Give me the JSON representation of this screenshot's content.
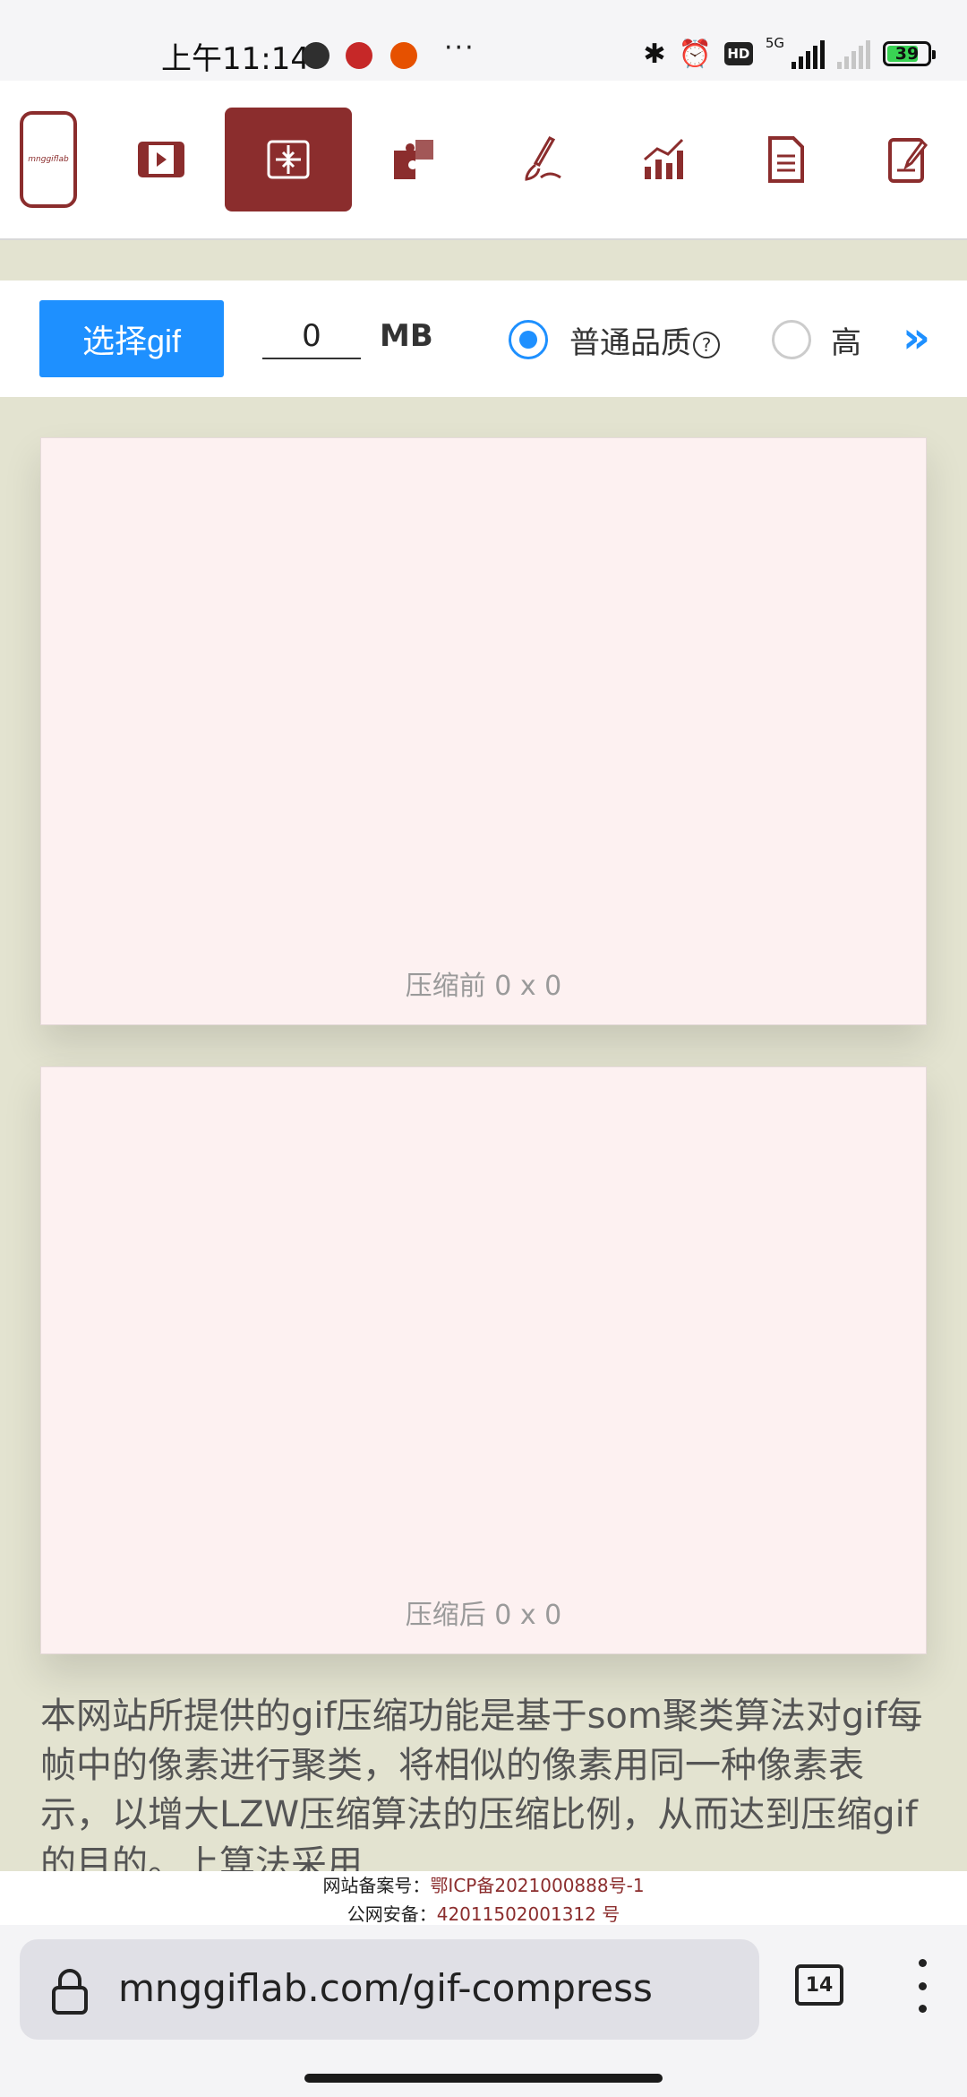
{
  "status_bar": {
    "time": "上午11:14",
    "battery": "39",
    "network": "5G",
    "hd_badge": "HD"
  },
  "toolbar": {
    "logo_text": "mnggiflab",
    "tools": [
      "logo",
      "video-to-gif",
      "gif-compress",
      "gif-puzzle",
      "gif-draw",
      "gif-chart",
      "document",
      "notes"
    ],
    "active_tool": "gif-compress"
  },
  "options": {
    "select_label": "选择gif",
    "size_value": "0",
    "size_unit": "MB",
    "quality_normal": "普通品质",
    "quality_help": "?",
    "quality_high": "高",
    "selected_quality": "normal",
    "accent_color": "#1e90ff"
  },
  "preview": {
    "before_caption": "压缩前 0 x 0",
    "after_caption": "压缩后 0 x 0"
  },
  "description": "本网站所提供的gif压缩功能是基于som聚类算法对gif每帧中的像素进行聚类，将相似的像素用同一种像素表示，以增大LZW压缩算法的压缩比例，从而达到压缩gif的目的。上算法采用",
  "footer": {
    "icp_label": "网站备案号：",
    "icp_value": "鄂ICP备2021000888号-1",
    "police_label": "公网安备：",
    "police_value": "42011502001312 号"
  },
  "browser": {
    "url": "mnggiflab.com/gif-compress",
    "tab_count": "14"
  },
  "brand_color": "#8b2d2d"
}
